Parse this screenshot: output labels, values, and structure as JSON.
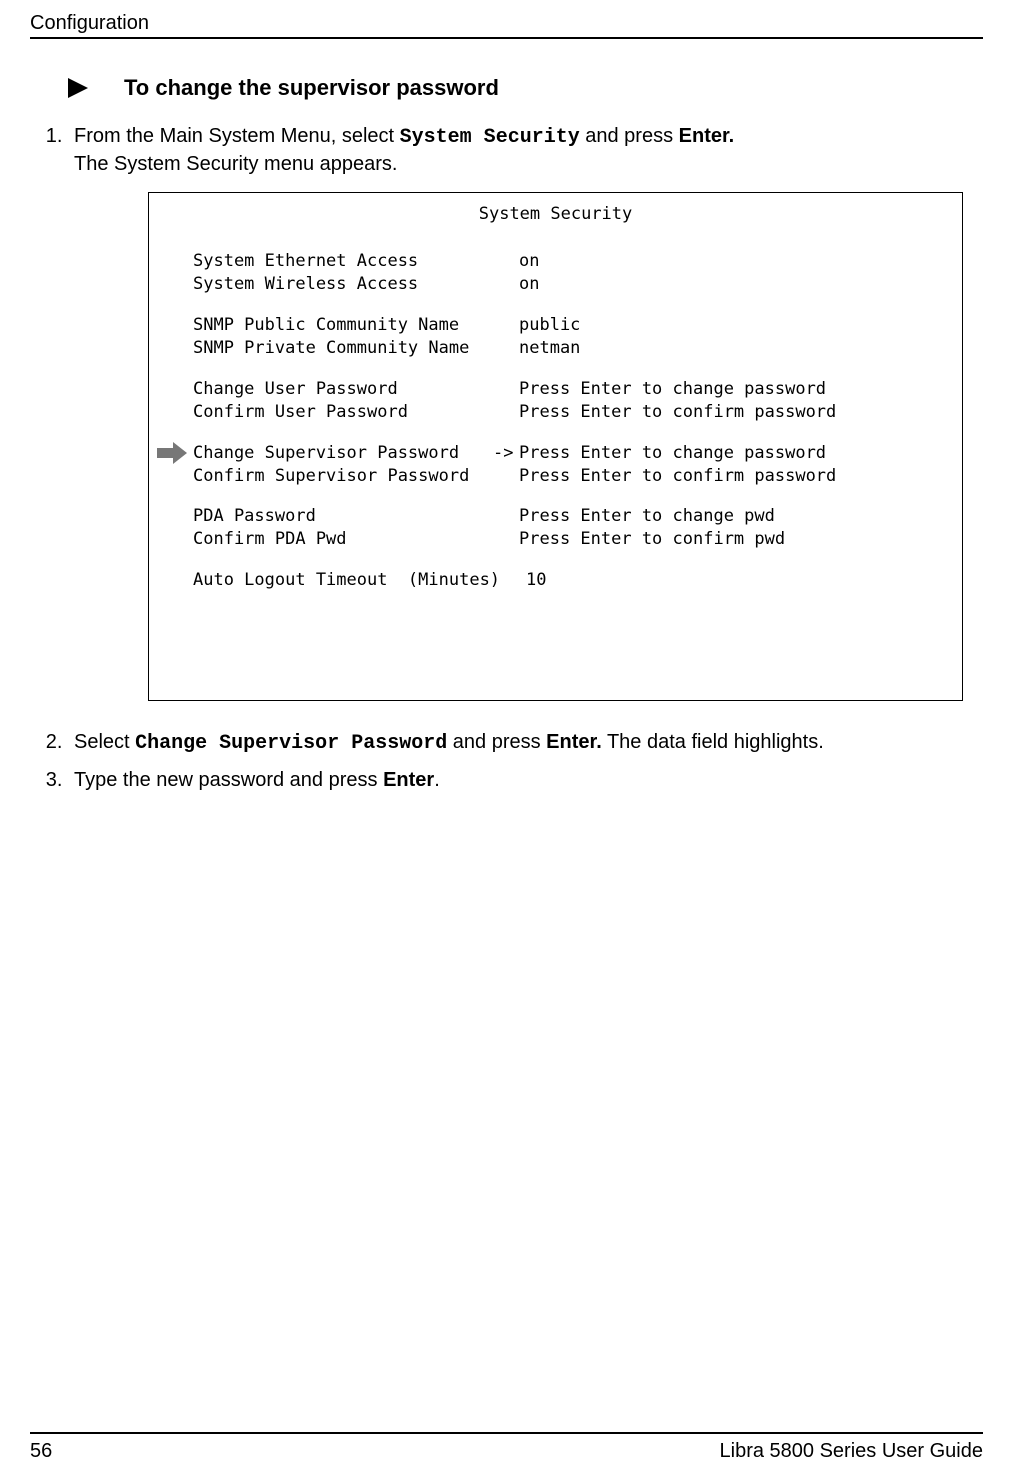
{
  "header": {
    "running_title": "Configuration"
  },
  "task": {
    "title": "To change the supervisor password"
  },
  "steps": {
    "s1_a": "From the Main System Menu, select ",
    "s1_code": "System Security",
    "s1_b": " and press ",
    "s1_ui": "Enter.",
    "s1_c": "The System Security menu appears.",
    "s2_a": "Select ",
    "s2_code": "Change Supervisor Password",
    "s2_b": " and press ",
    "s2_ui": "Enter.",
    "s2_c": " The data field highlights.",
    "s3_a": "Type the new password and press ",
    "s3_ui": "Enter",
    "s3_b": "."
  },
  "terminal": {
    "title": "System Security",
    "rows": [
      [
        {
          "label": "System Ethernet Access",
          "arrow": "",
          "value": "on"
        },
        {
          "label": "System Wireless Access",
          "arrow": "",
          "value": "on"
        }
      ],
      [
        {
          "label": "SNMP Public Community Name",
          "arrow": "",
          "value": "public"
        },
        {
          "label": "SNMP Private Community Name",
          "arrow": "",
          "value": "netman"
        }
      ],
      [
        {
          "label": "Change User Password",
          "arrow": "",
          "value": "Press Enter to change password"
        },
        {
          "label": "Confirm User Password",
          "arrow": "",
          "value": "Press Enter to confirm password"
        }
      ],
      [
        {
          "label": "Change Supervisor Password",
          "arrow": "->",
          "value": "Press Enter to change password",
          "pointer": true
        },
        {
          "label": "Confirm Supervisor Password",
          "arrow": "",
          "value": "Press Enter to confirm password"
        }
      ],
      [
        {
          "label": "PDA Password",
          "arrow": "",
          "value": "Press Enter to change pwd"
        },
        {
          "label": "Confirm PDA Pwd",
          "arrow": "",
          "value": "Press Enter to confirm pwd"
        }
      ],
      [
        {
          "label": "Auto Logout Timeout  (Minutes)",
          "arrow": "",
          "value": "10"
        }
      ]
    ]
  },
  "footer": {
    "page_number": "56",
    "doc_title": "Libra 5800 Series User Guide"
  }
}
